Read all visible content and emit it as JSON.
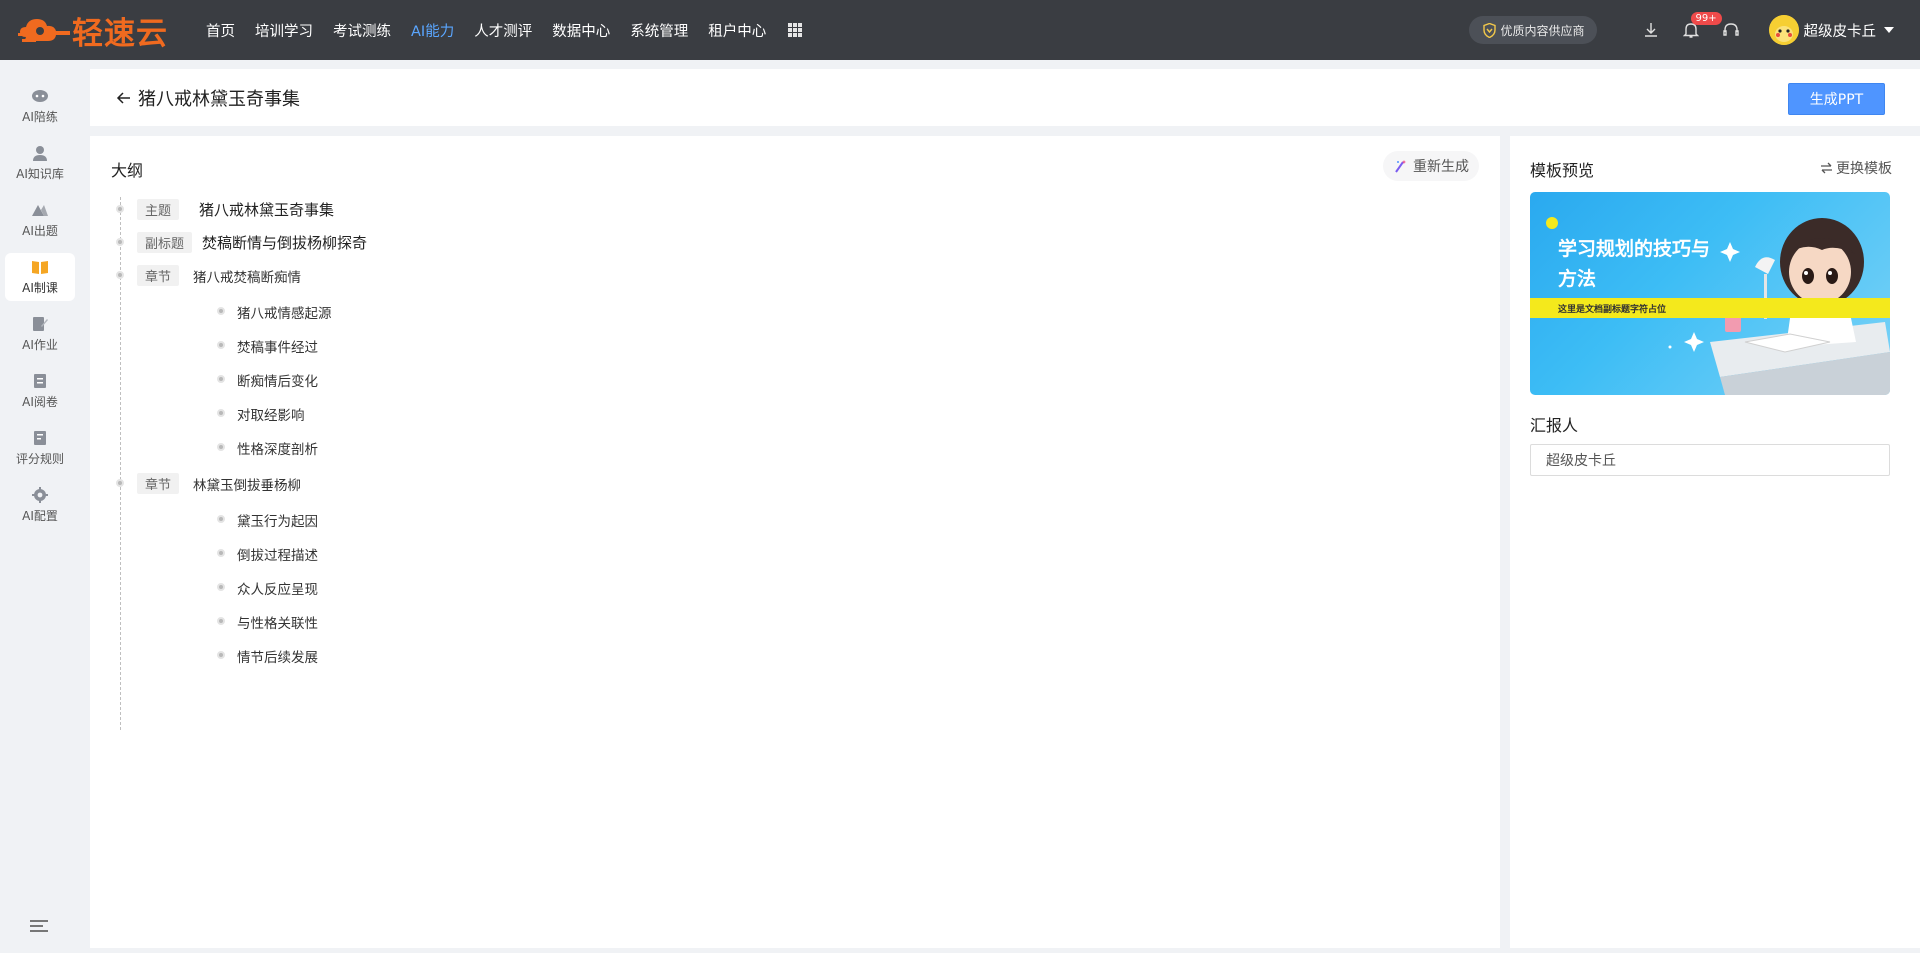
{
  "app": {
    "brand": "轻速云",
    "nav": [
      {
        "label": "首页",
        "active": false
      },
      {
        "label": "培训学习",
        "active": false
      },
      {
        "label": "考试测练",
        "active": false
      },
      {
        "label": "AI能力",
        "active": true
      },
      {
        "label": "人才测评",
        "active": false
      },
      {
        "label": "数据中心",
        "active": false
      },
      {
        "label": "系统管理",
        "active": false
      },
      {
        "label": "租户中心",
        "active": false
      }
    ],
    "supplier_badge": "优质内容供应商",
    "notification_count": "99+",
    "user_name": "超级皮卡丘",
    "accent_color": "#4f95ff",
    "brand_color": "#f06a1f"
  },
  "sidebar": {
    "items": [
      {
        "label": "AI陪练",
        "icon": "chat-robot-icon",
        "active": false
      },
      {
        "label": "AI知识库",
        "icon": "user-book-icon",
        "active": false
      },
      {
        "label": "AI出题",
        "icon": "triangle-pen-icon",
        "active": false
      },
      {
        "label": "AI制课",
        "icon": "open-book-icon",
        "active": true
      },
      {
        "label": "AI作业",
        "icon": "edit-doc-icon",
        "active": false
      },
      {
        "label": "AI阅卷",
        "icon": "review-doc-icon",
        "active": false
      },
      {
        "label": "评分规则",
        "icon": "rules-doc-icon",
        "active": false
      },
      {
        "label": "AI配置",
        "icon": "gear-icon",
        "active": false
      }
    ]
  },
  "header": {
    "title": "猪八戒林黛玉奇事集",
    "generate_button": "生成PPT"
  },
  "outline": {
    "title": "大纲",
    "regenerate": "重新生成",
    "topic": {
      "tag": "主题",
      "text": "猪八戒林黛玉奇事集"
    },
    "subtitle": {
      "tag": "副标题",
      "text": "焚稿断情与倒拔杨柳探奇"
    },
    "chapters": [
      {
        "tag": "章节",
        "title": "猪八戒焚稿断痴情",
        "items": [
          "猪八戒情感起源",
          "焚稿事件经过",
          "断痴情后变化",
          "对取经影响",
          "性格深度剖析"
        ]
      },
      {
        "tag": "章节",
        "title": "林黛玉倒拔垂杨柳",
        "items": [
          "黛玉行为起因",
          "倒拔过程描述",
          "众人反应呈现",
          "与性格关联性",
          "情节后续发展"
        ]
      }
    ]
  },
  "template": {
    "title": "模板预览",
    "swap": "更换模板",
    "thumb_title": "学习规划的技巧与方法",
    "thumb_subtitle": "这里是文档副标题字符占位",
    "reporter_label": "汇报人",
    "reporter_value": "超级皮卡丘"
  }
}
